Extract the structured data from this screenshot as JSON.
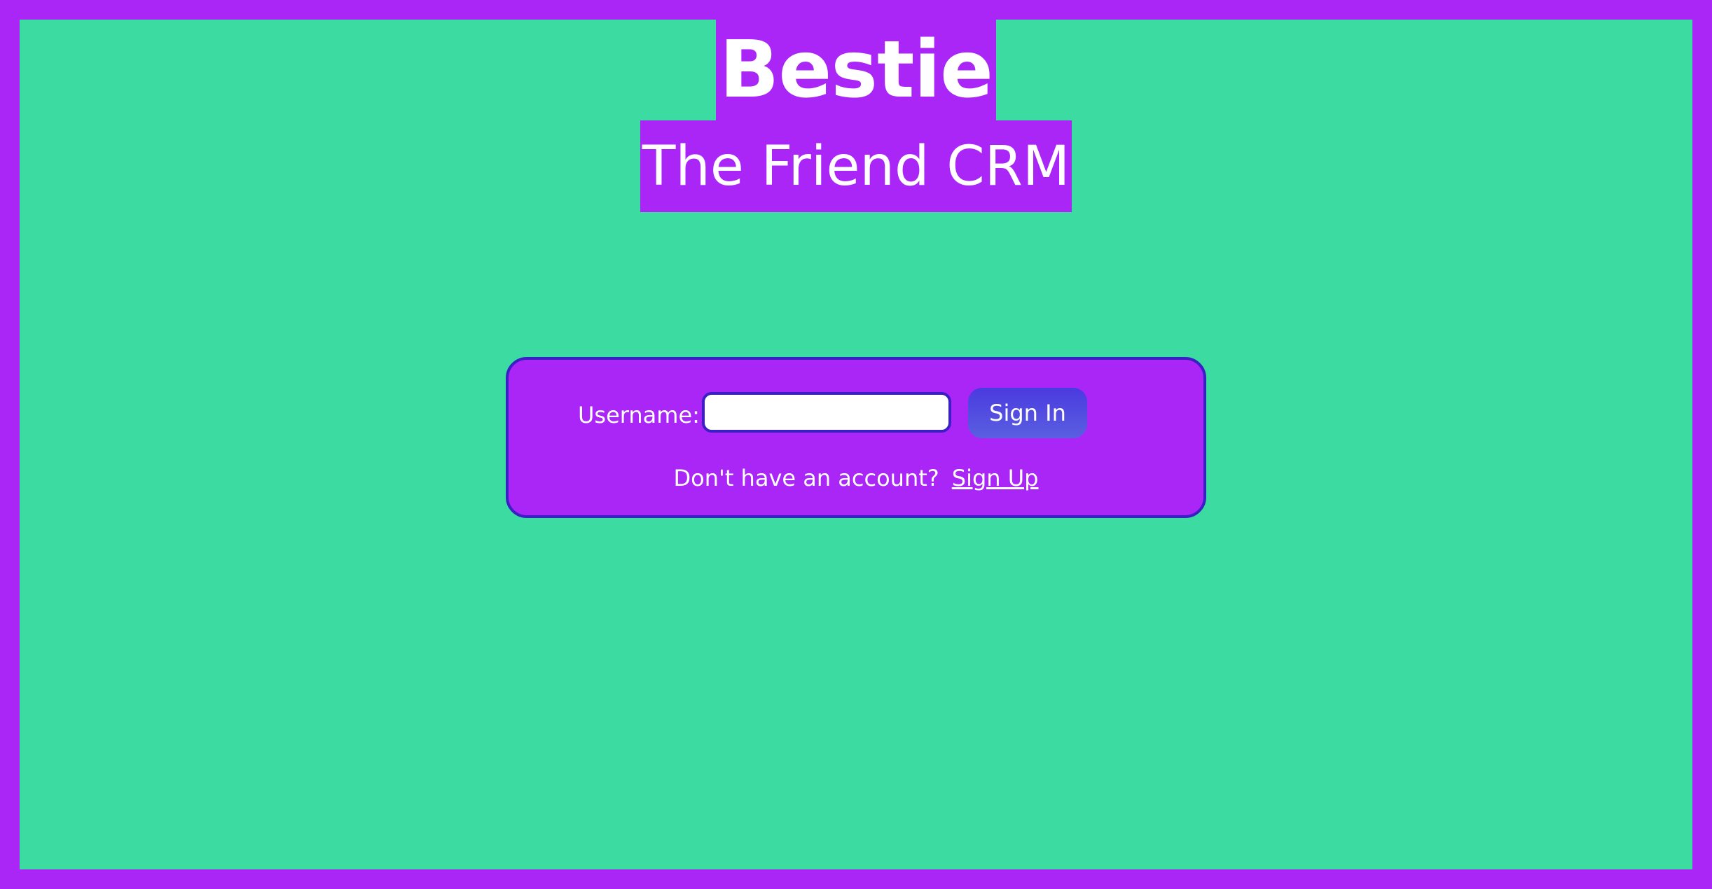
{
  "app": {
    "title": "Bestie",
    "subtitle": "The Friend CRM"
  },
  "login": {
    "username_label": "Username:",
    "username_value": "",
    "sign_in_label": "Sign In",
    "signup_prompt": "Don't have an account?",
    "signup_link_label": "Sign Up"
  },
  "colors": {
    "background": "#3bdba1",
    "accent": "#a926f7",
    "border": "#3a1fc4",
    "button": "#4a3ae0",
    "text": "#ffffff"
  }
}
